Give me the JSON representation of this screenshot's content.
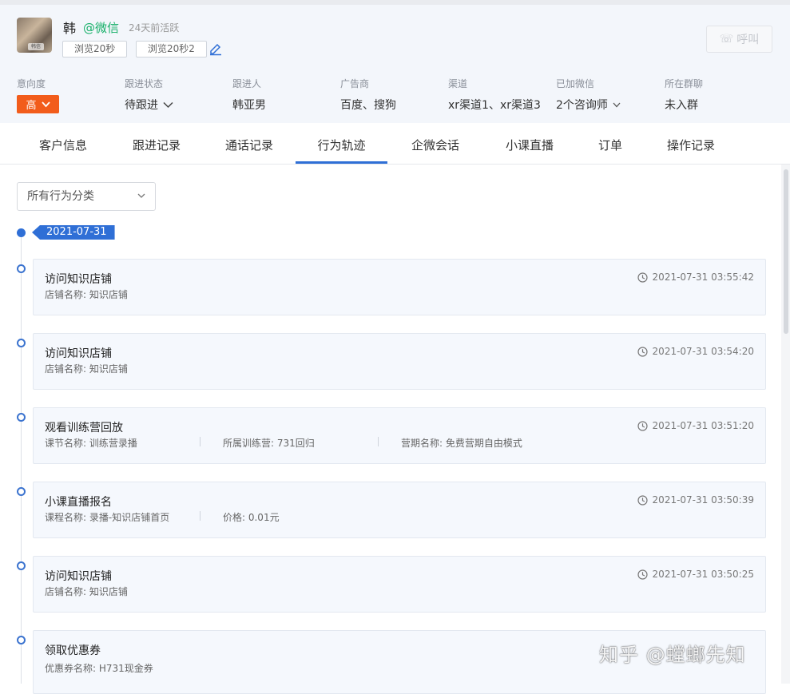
{
  "customer": {
    "name": "韩",
    "wechat_tag": "@微信",
    "active_text": "24天前活跃",
    "avatar_caption": "韩信",
    "tags": [
      "浏览20秒",
      "浏览20秒2"
    ],
    "call_label": "呼叫"
  },
  "fields": [
    {
      "label": "意向度",
      "value": "高"
    },
    {
      "label": "跟进状态",
      "value": "待跟进"
    },
    {
      "label": "跟进人",
      "value": "韩亚男"
    },
    {
      "label": "广告商",
      "value": "百度、搜狗"
    },
    {
      "label": "渠道",
      "value": "xr渠道1、xr渠道3"
    },
    {
      "label": "已加微信",
      "value": "2个咨询师"
    },
    {
      "label": "所在群聊",
      "value": "未入群"
    }
  ],
  "tabs": [
    "客户信息",
    "跟进记录",
    "通话记录",
    "行为轨迹",
    "企微会话",
    "小课直播",
    "订单",
    "操作记录"
  ],
  "active_tab": "行为轨迹",
  "filter": {
    "label": "所有行为分类"
  },
  "timeline": {
    "date": "2021-07-31",
    "events": [
      {
        "title": "访问知识店铺",
        "time": "2021-07-31 03:55:42",
        "meta": [
          "店铺名称: 知识店铺"
        ]
      },
      {
        "title": "访问知识店铺",
        "time": "2021-07-31 03:54:20",
        "meta": [
          "店铺名称: 知识店铺"
        ]
      },
      {
        "title": "观看训练营回放",
        "time": "2021-07-31 03:51:20",
        "meta": [
          "课节名称: 训练营录播",
          "所属训练营: 731回归",
          "营期名称: 免费营期自由模式"
        ]
      },
      {
        "title": "小课直播报名",
        "time": "2021-07-31 03:50:39",
        "meta": [
          "课程名称: 录播-知识店铺首页",
          "价格: 0.01元"
        ]
      },
      {
        "title": "访问知识店铺",
        "time": "2021-07-31 03:50:25",
        "meta": [
          "店铺名称: 知识店铺"
        ]
      },
      {
        "title": "领取优惠券",
        "time": "",
        "meta": [
          "优惠券名称: H731现金券"
        ]
      }
    ]
  },
  "watermark": "知乎 @螳螂先知",
  "colors": {
    "accent": "#2f6fd6",
    "intent_high": "#f25c1b",
    "wechat_green": "#18b06a",
    "header_bg": "#f3f6fb"
  }
}
